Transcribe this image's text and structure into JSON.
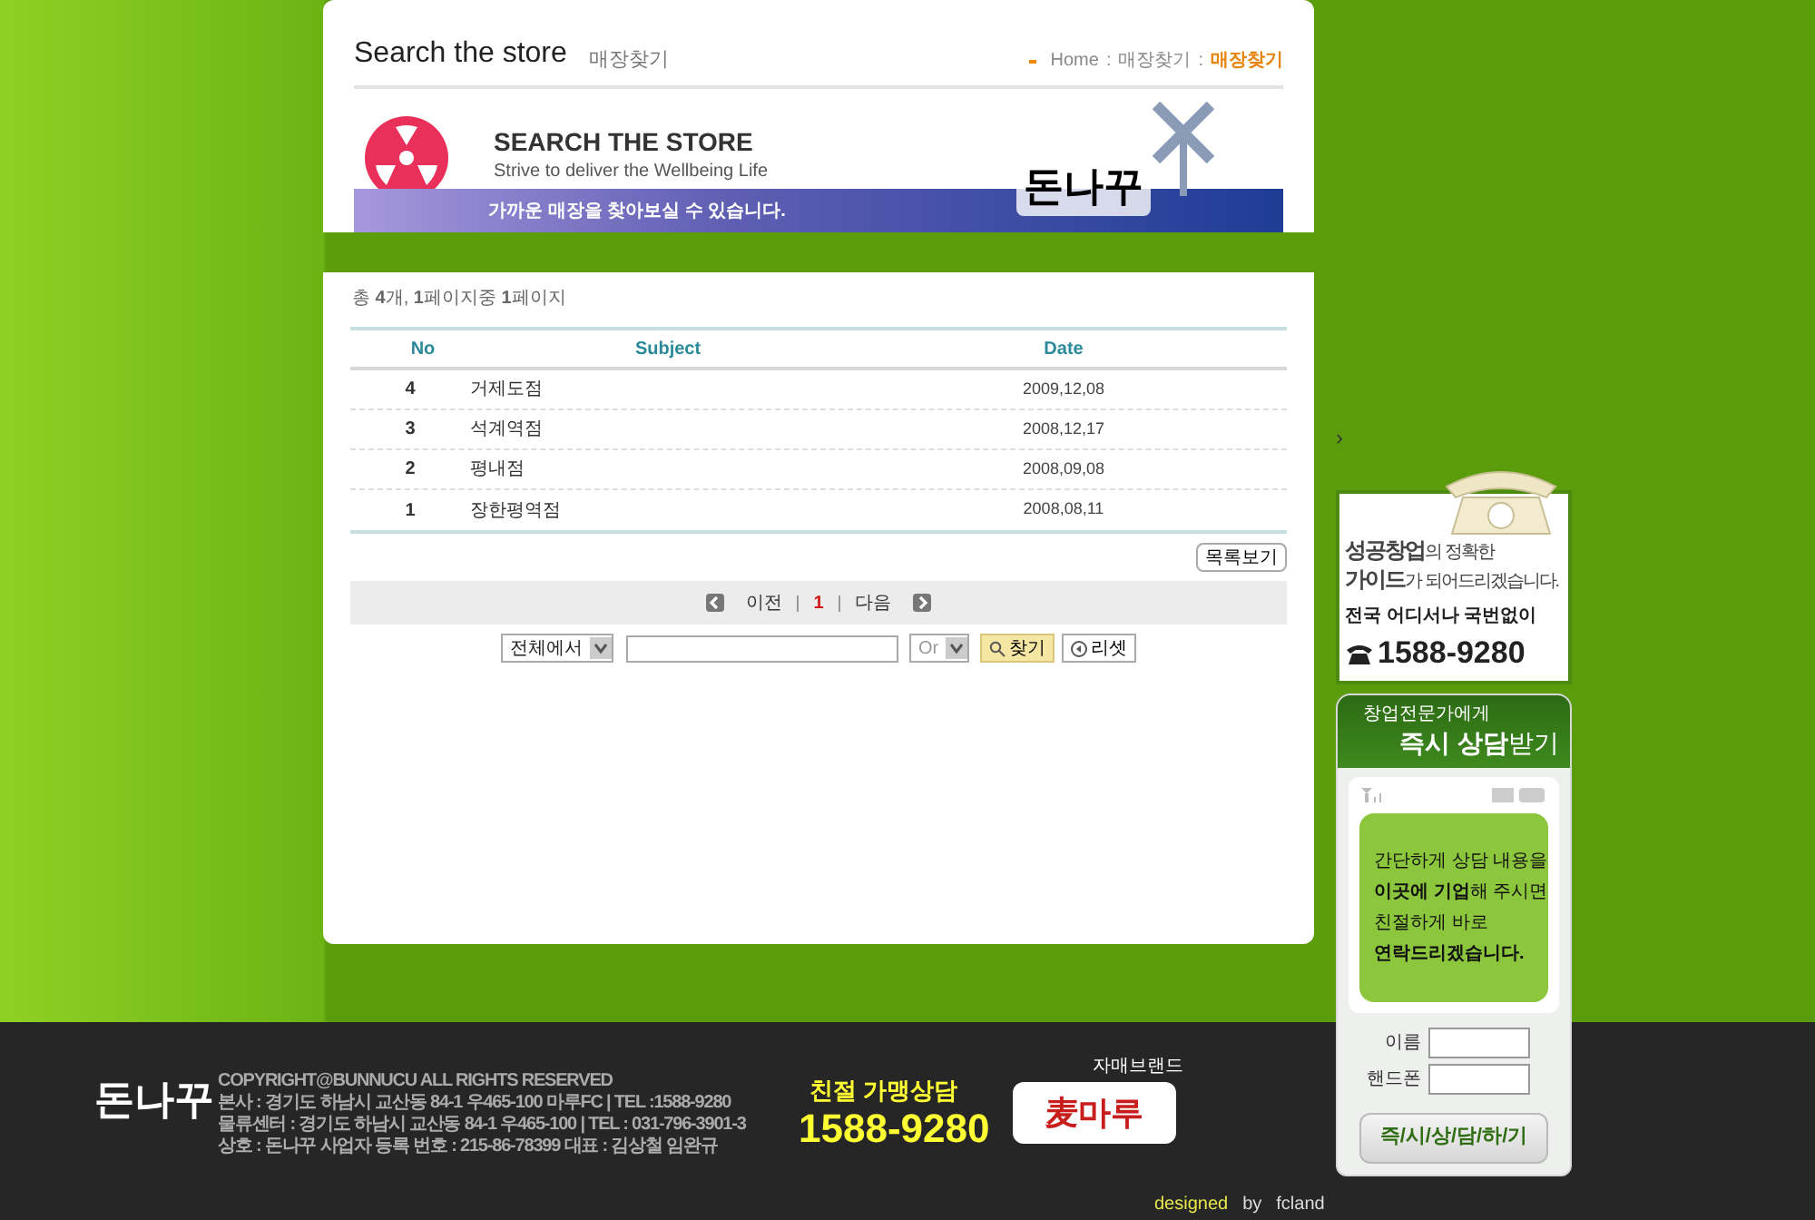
{
  "header": {
    "title": "Search the store",
    "subtitle": "매장찾기",
    "breadcrumb": {
      "separator": ":",
      "items": [
        {
          "label": "Home",
          "selected": false
        },
        {
          "label": "매장찾기",
          "selected": false
        },
        {
          "label": "매장찾기",
          "selected": true
        }
      ]
    }
  },
  "banner": {
    "heading": "SEARCH THE STORE",
    "tagline": "Strive to deliver the Wellbeing Life",
    "strip_text": "가까운 매장을 찾아보실 수 있습니다.",
    "logo_text": "돈나꾸"
  },
  "summary": "총 **4**개, **1**페이지중 **1**페이지",
  "table": {
    "columns": [
      "No",
      "Subject",
      "Date"
    ],
    "rows": [
      {
        "no": "4",
        "subject": "거제도점",
        "date": "2009,12,08"
      },
      {
        "no": "3",
        "subject": "석계역점",
        "date": "2008,12,17"
      },
      {
        "no": "2",
        "subject": "평내점",
        "date": "2008,09,08"
      },
      {
        "no": "1",
        "subject": "장한평역점",
        "date": "2008,08,11"
      }
    ]
  },
  "list_button": "목록보기",
  "pagination": {
    "prev": "이전",
    "next": "다음",
    "pages": [
      {
        "label": "1",
        "selected": true
      }
    ]
  },
  "search": {
    "scope": "전체에서",
    "operator": "Or",
    "search_button": "찾기",
    "reset_button": "리셋"
  },
  "side_arrow": "›",
  "promo": {
    "lines": [
      "**성공창업**의 정확한",
      "**가이드**가 되어드리겠습니다."
    ],
    "note": "전국 어디서나 국번없이",
    "phone": "1588-9280"
  },
  "consult": {
    "heading": "창업전문가에게",
    "subheading": "**즉시 상담**받기",
    "message": [
      "간단하게 상담 내용을",
      "**이곳에 기업**해 주시면",
      "친절하게 바로",
      "**연락드리겠습니다.**"
    ],
    "fields": [
      {
        "label": "이름"
      },
      {
        "label": "핸드폰"
      }
    ],
    "button": "즉/시/상/담/하/기"
  },
  "footer": {
    "logo_text": "돈나꾸",
    "lines": [
      "COPYRIGHT@BUNNUCU ALL RIGHTS RESERVED",
      "본사 : 경기도 하남시 교산동 84-1 우465-100 마루FC  |  TEL :1588-9280",
      "물류센터 : 경기도 하남시 교산동 84-1 우465-100  |  TEL : 031-796-3901-3",
      "상호 : 돈나꾸 사업자 등록 번호 : 215-86-78399  대표 : 김상철 임완규"
    ],
    "hotline_label": "친절 가맹상담",
    "hotline": "1588-9280",
    "brand_label": "자매브랜드",
    "brand_logo": "麦마루",
    "credit": [
      "designed",
      "by",
      "fcland"
    ]
  }
}
